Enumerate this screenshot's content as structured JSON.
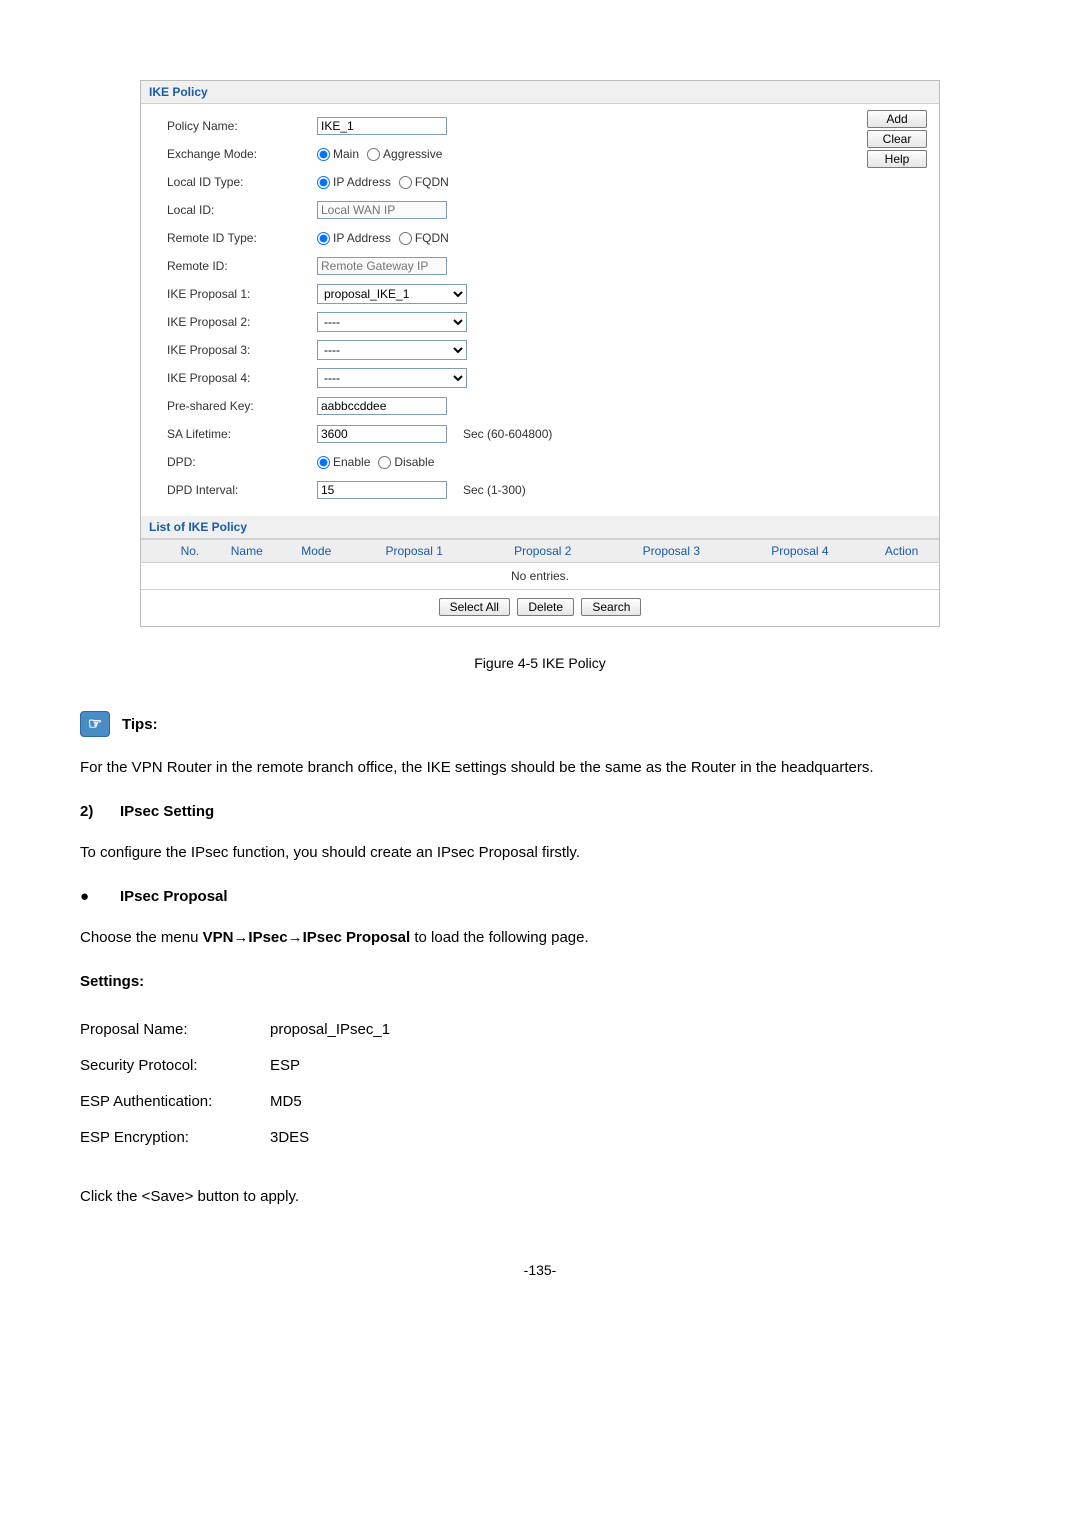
{
  "panel": {
    "title": "IKE Policy",
    "side_buttons": {
      "add": "Add",
      "clear": "Clear",
      "help": "Help"
    },
    "rows": {
      "policy_name": {
        "label": "Policy Name:",
        "value": "IKE_1"
      },
      "exchange_mode": {
        "label": "Exchange Mode:",
        "opt1": "Main",
        "opt2": "Aggressive"
      },
      "local_id_type": {
        "label": "Local ID Type:",
        "opt1": "IP Address",
        "opt2": "FQDN"
      },
      "local_id": {
        "label": "Local ID:",
        "placeholder": "Local WAN IP"
      },
      "remote_id_type": {
        "label": "Remote ID Type:",
        "opt1": "IP Address",
        "opt2": "FQDN"
      },
      "remote_id": {
        "label": "Remote ID:",
        "placeholder": "Remote Gateway IP"
      },
      "ike_p1": {
        "label": "IKE Proposal 1:",
        "value": "proposal_IKE_1"
      },
      "ike_p2": {
        "label": "IKE Proposal 2:",
        "value": "----"
      },
      "ike_p3": {
        "label": "IKE Proposal 3:",
        "value": "----"
      },
      "ike_p4": {
        "label": "IKE Proposal 4:",
        "value": "----"
      },
      "psk": {
        "label": "Pre-shared Key:",
        "value": "aabbccddee"
      },
      "sa_life": {
        "label": "SA Lifetime:",
        "value": "3600",
        "unit": "Sec (60-604800)"
      },
      "dpd": {
        "label": "DPD:",
        "opt1": "Enable",
        "opt2": "Disable"
      },
      "dpd_int": {
        "label": "DPD Interval:",
        "value": "15",
        "unit": "Sec (1-300)"
      }
    },
    "list": {
      "title": "List of IKE Policy",
      "headers": {
        "no": "No.",
        "name": "Name",
        "mode": "Mode",
        "p1": "Proposal 1",
        "p2": "Proposal 2",
        "p3": "Proposal 3",
        "p4": "Proposal 4",
        "action": "Action"
      },
      "empty": "No entries.",
      "buttons": {
        "select_all": "Select All",
        "delete": "Delete",
        "search": "Search"
      }
    }
  },
  "doc": {
    "figure_caption": "Figure 4-5 IKE Policy",
    "tips_label": "Tips:",
    "tips_body": "For the VPN Router in the remote branch office, the IKE settings should be the same as the Router in the headquarters.",
    "h2_num": "2)",
    "h2_text": "IPsec Setting",
    "p_setting": "To configure the IPsec function, you should create an IPsec Proposal firstly.",
    "bullet_text": "IPsec Proposal",
    "menu_line_pre": "Choose the menu ",
    "menu_line_bold": "VPN→IPsec→IPsec Proposal",
    "menu_line_post": " to load the following page.",
    "settings_label": "Settings:",
    "settings": {
      "r1k": "Proposal Name:",
      "r1v": "proposal_IPsec_1",
      "r2k": "Security Protocol:",
      "r2v": "ESP",
      "r3k": "ESP Authentication:",
      "r3v": "MD5",
      "r4k": "ESP Encryption:",
      "r4v": "3DES"
    },
    "apply_line": "Click the <Save> button to apply.",
    "page_num": "-135-"
  }
}
